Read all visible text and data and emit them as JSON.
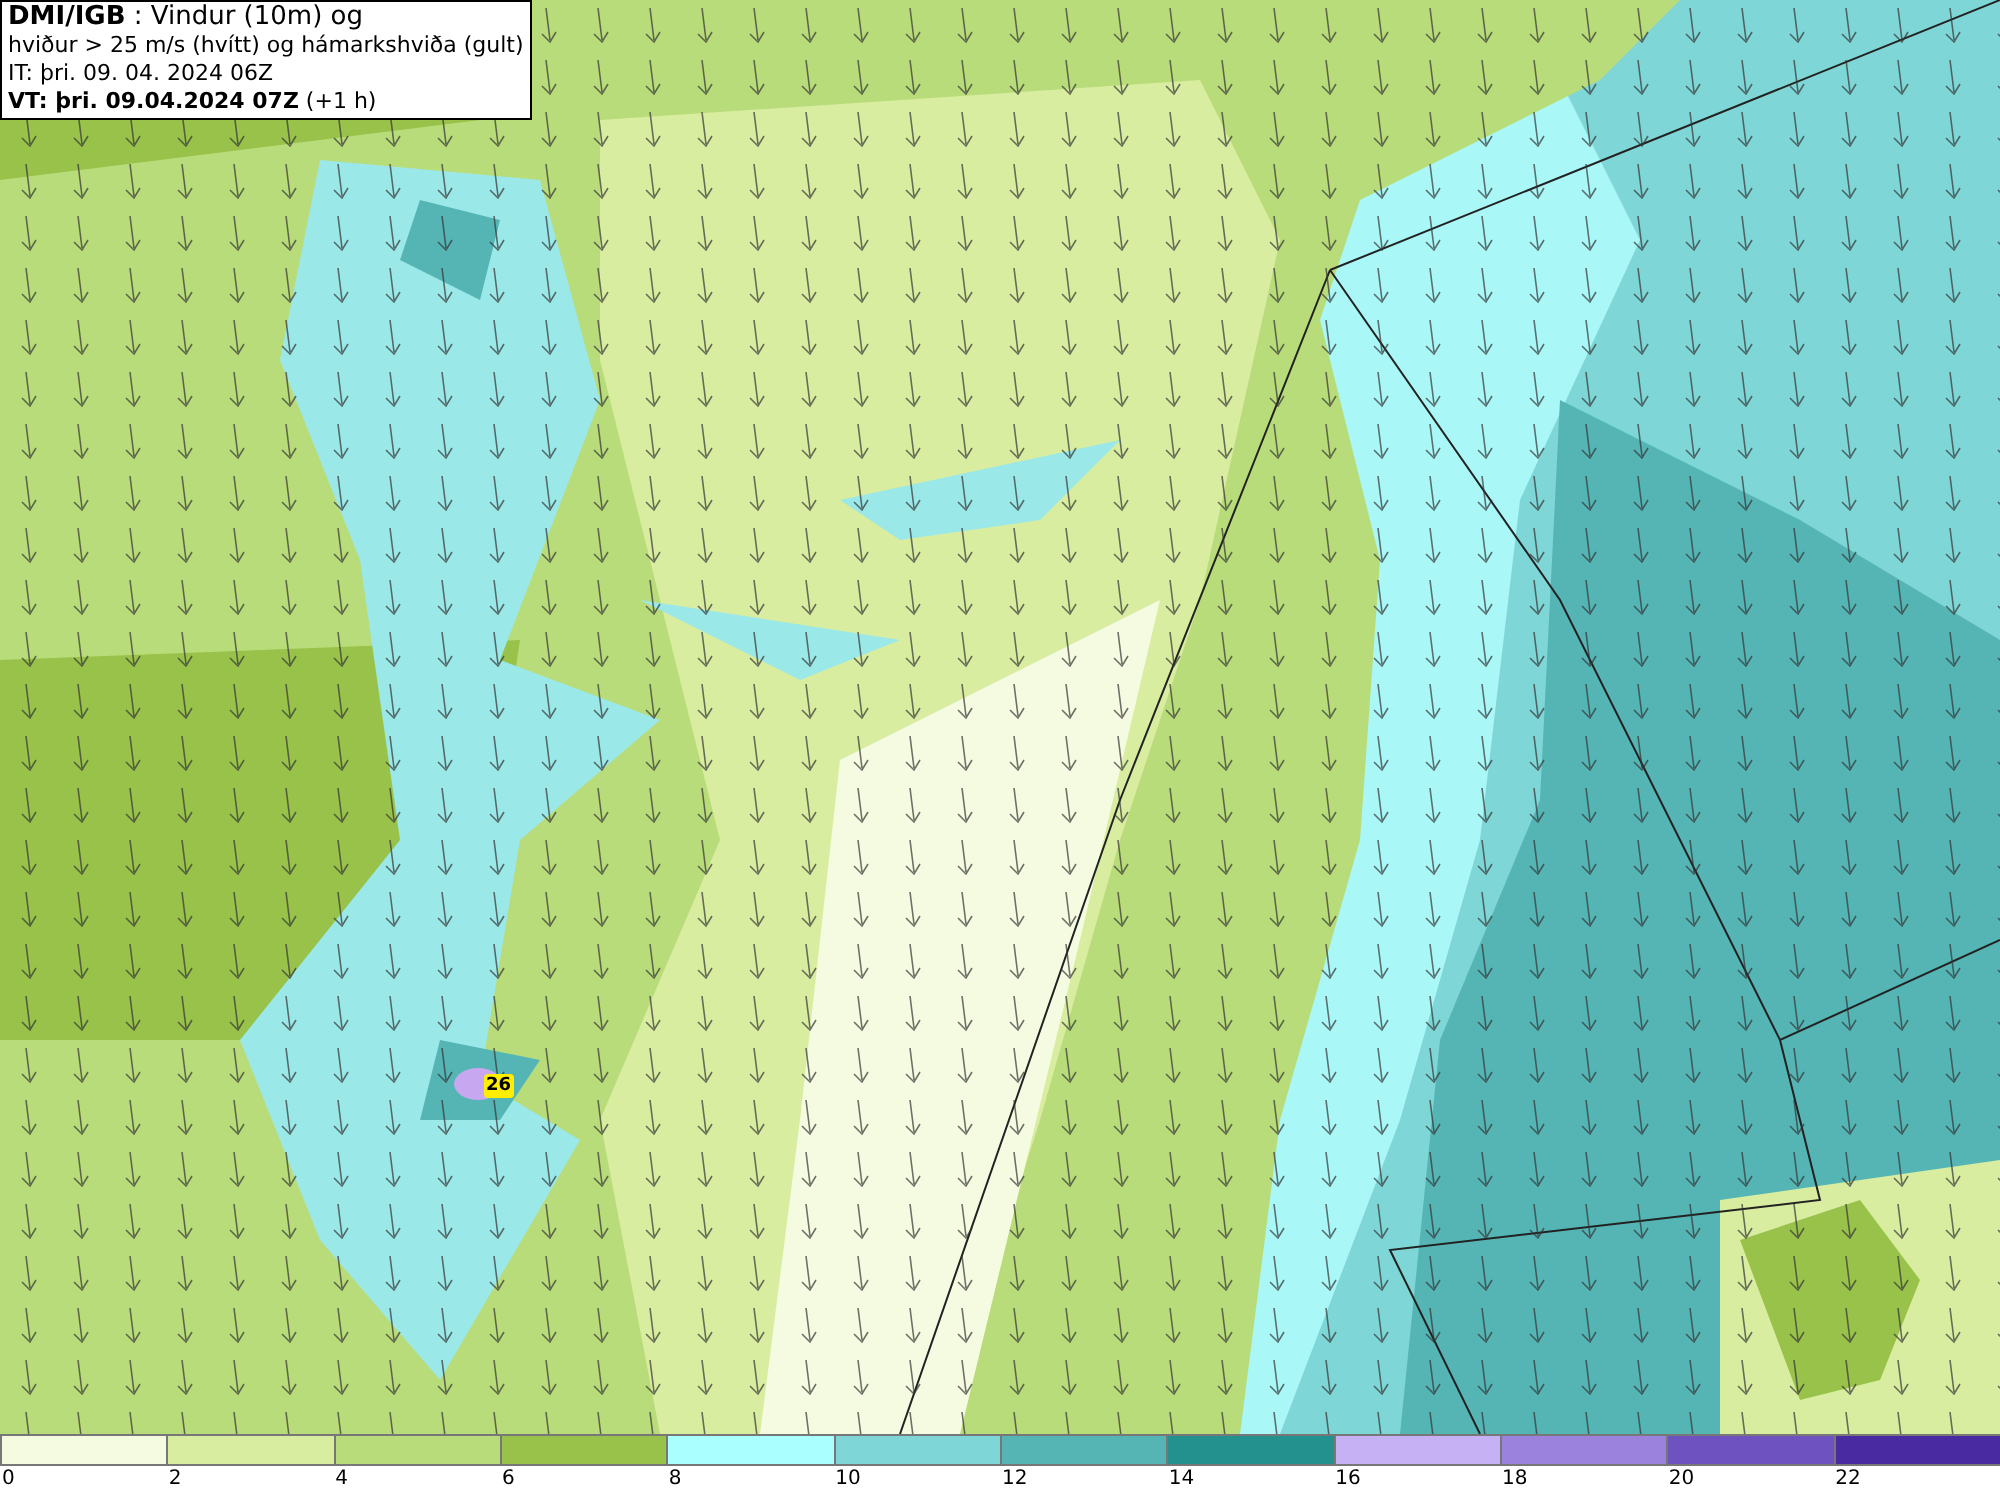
{
  "title_box": {
    "line_1": "**DMI/IGB** : Vindur (10m) og",
    "line_2": "hviður > 25 m/s (hvítt) og hámarkshviða (gult)",
    "line_3": "IT: þri. 09. 04. 2024 06Z",
    "line_4": "**VT: þri. 09.04.2024 07Z** (+1 h)"
  },
  "map": {
    "max_gust_label": "26"
  },
  "legend": [
    {
      "label": "0",
      "color": "#f5fbe0"
    },
    {
      "label": "2",
      "color": "#d8eda0"
    },
    {
      "label": "4",
      "color": "#b9dc7a"
    },
    {
      "label": "6",
      "color": "#98c24a"
    },
    {
      "label": "8",
      "color": "#aaffff"
    },
    {
      "label": "10",
      "color": "#7fd6d6"
    },
    {
      "label": "12",
      "color": "#55b5b5"
    },
    {
      "label": "14",
      "color": "#23918e"
    },
    {
      "label": "16",
      "color": "#c7b1f5"
    },
    {
      "label": "18",
      "color": "#9b82dc"
    },
    {
      "label": "20",
      "color": "#6e52c0"
    },
    {
      "label": "22",
      "color": "#4a2aa0"
    }
  ]
}
